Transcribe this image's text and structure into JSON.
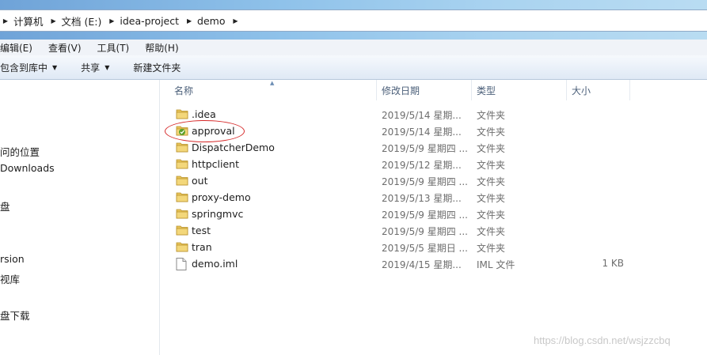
{
  "breadcrumb": {
    "items": [
      {
        "label": "计算机"
      },
      {
        "label": "文档 (E:)"
      },
      {
        "label": "idea-project"
      },
      {
        "label": "demo"
      }
    ]
  },
  "menubar": {
    "items": [
      "编辑(E)",
      "查看(V)",
      "工具(T)",
      "帮助(H)"
    ]
  },
  "toolbar": {
    "include_library": "包含到库中",
    "share": "共享",
    "new_folder": "新建文件夹"
  },
  "nav": {
    "items": [
      "问的位置",
      "Downloads",
      "盘",
      "rsion",
      "视库",
      "盘下载"
    ]
  },
  "columns": {
    "name": "名称",
    "date": "修改日期",
    "type": "类型",
    "size": "大小"
  },
  "files": [
    {
      "name": ".idea",
      "date": "2019/5/14 星期...",
      "type": "文件夹",
      "size": "",
      "icon": "folder-icon"
    },
    {
      "name": "approval",
      "date": "2019/5/14 星期...",
      "type": "文件夹",
      "size": "",
      "icon": "app-folder-icon"
    },
    {
      "name": "DispatcherDemo",
      "date": "2019/5/9 星期四 ...",
      "type": "文件夹",
      "size": "",
      "icon": "folder-icon"
    },
    {
      "name": "httpclient",
      "date": "2019/5/12 星期...",
      "type": "文件夹",
      "size": "",
      "icon": "folder-icon"
    },
    {
      "name": "out",
      "date": "2019/5/9 星期四 ...",
      "type": "文件夹",
      "size": "",
      "icon": "folder-icon"
    },
    {
      "name": "proxy-demo",
      "date": "2019/5/13 星期...",
      "type": "文件夹",
      "size": "",
      "icon": "folder-icon"
    },
    {
      "name": "springmvc",
      "date": "2019/5/9 星期四 ...",
      "type": "文件夹",
      "size": "",
      "icon": "folder-icon"
    },
    {
      "name": "test",
      "date": "2019/5/9 星期四 ...",
      "type": "文件夹",
      "size": "",
      "icon": "folder-icon"
    },
    {
      "name": "tran",
      "date": "2019/5/5 星期日 ...",
      "type": "文件夹",
      "size": "",
      "icon": "folder-icon"
    },
    {
      "name": "demo.iml",
      "date": "2019/4/15 星期...",
      "type": "IML 文件",
      "size": "1 KB",
      "icon": "file-icon"
    }
  ],
  "watermark": "https://blog.csdn.net/wsjzzcbq",
  "colors": {
    "folder": "#e8c45a",
    "highlight_circle": "#d62a2a",
    "app_icon": "#5aa02c"
  }
}
